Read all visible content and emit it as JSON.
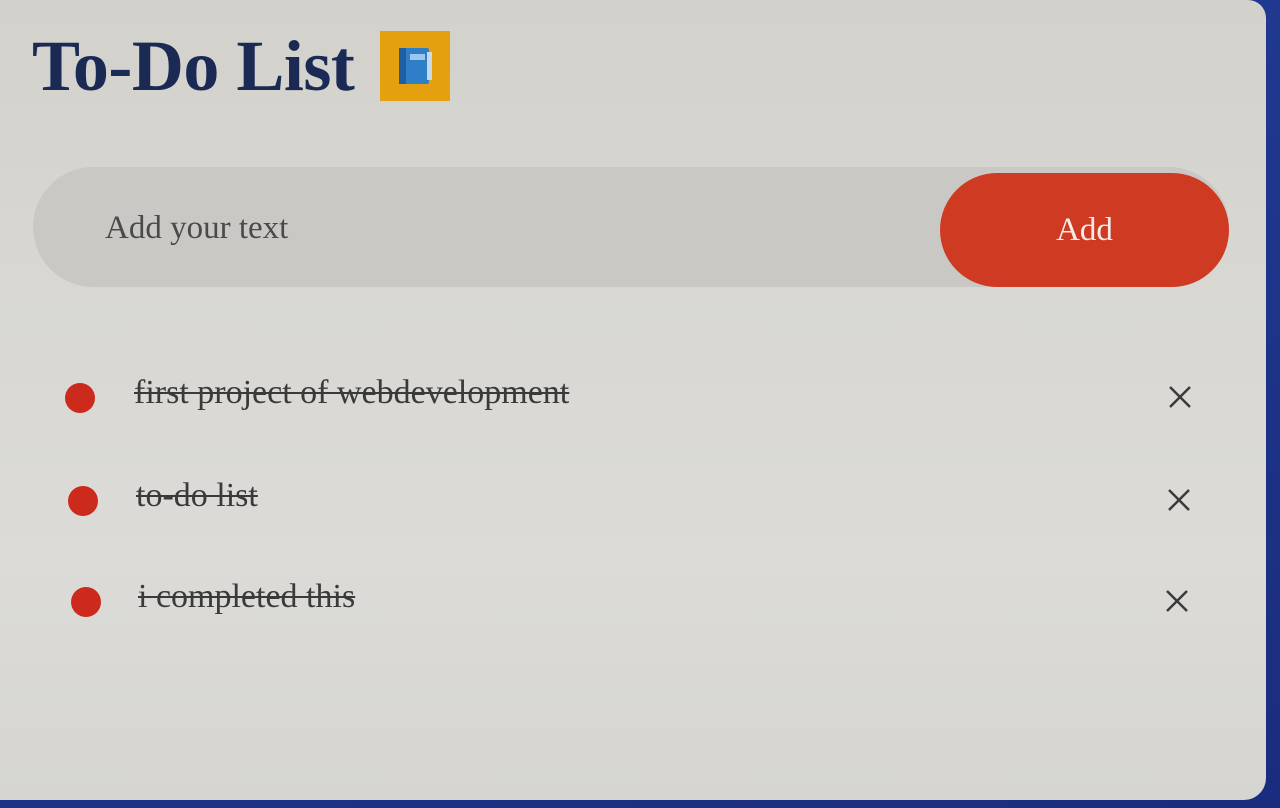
{
  "header": {
    "title": "To-Do List",
    "icon": "notebook-icon"
  },
  "input": {
    "placeholder": "Add your text",
    "value": ""
  },
  "add_button": {
    "label": "Add"
  },
  "tasks": [
    {
      "text": "first project of webdevelopment",
      "completed": true
    },
    {
      "text": "to-do list",
      "completed": true
    },
    {
      "text": "i completed this",
      "completed": true
    }
  ],
  "colors": {
    "accent": "#cf3a22",
    "bullet": "#cc2a1c",
    "title": "#1a2a55",
    "input_background": "#c9c8c4",
    "icon_background": "#e5a00f"
  },
  "icons": {
    "bullet": "red-dot-icon",
    "remove": "close-icon"
  }
}
